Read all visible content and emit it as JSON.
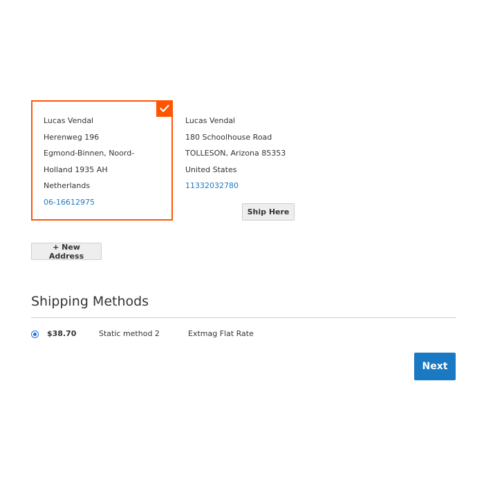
{
  "addresses": [
    {
      "name": "Lucas Vendal",
      "street": "Herenweg 196",
      "city_line_1": "Egmond-Binnen, Noord-",
      "city_line_2": "Holland 1935 AH",
      "country": "Netherlands",
      "phone": "06-16612975",
      "selected": true
    },
    {
      "name": "Lucas Vendal",
      "street": "180 Schoolhouse Road",
      "city_line": "TOLLESON, Arizona 85353",
      "country": "United States",
      "phone": "11332032780",
      "ship_here_label": "Ship Here",
      "selected": false
    }
  ],
  "new_address_label": "+ New Address",
  "shipping": {
    "title": "Shipping Methods",
    "methods": [
      {
        "price": "$38.70",
        "method": "Static method 2",
        "carrier": "Extmag Flat Rate",
        "selected": true
      }
    ]
  },
  "next_label": "Next",
  "colors": {
    "accent_orange": "#ff5501",
    "link_blue": "#1979c3",
    "radio_blue": "#1a73e8"
  },
  "icons": {
    "selected_badge": "checkmark-icon"
  }
}
